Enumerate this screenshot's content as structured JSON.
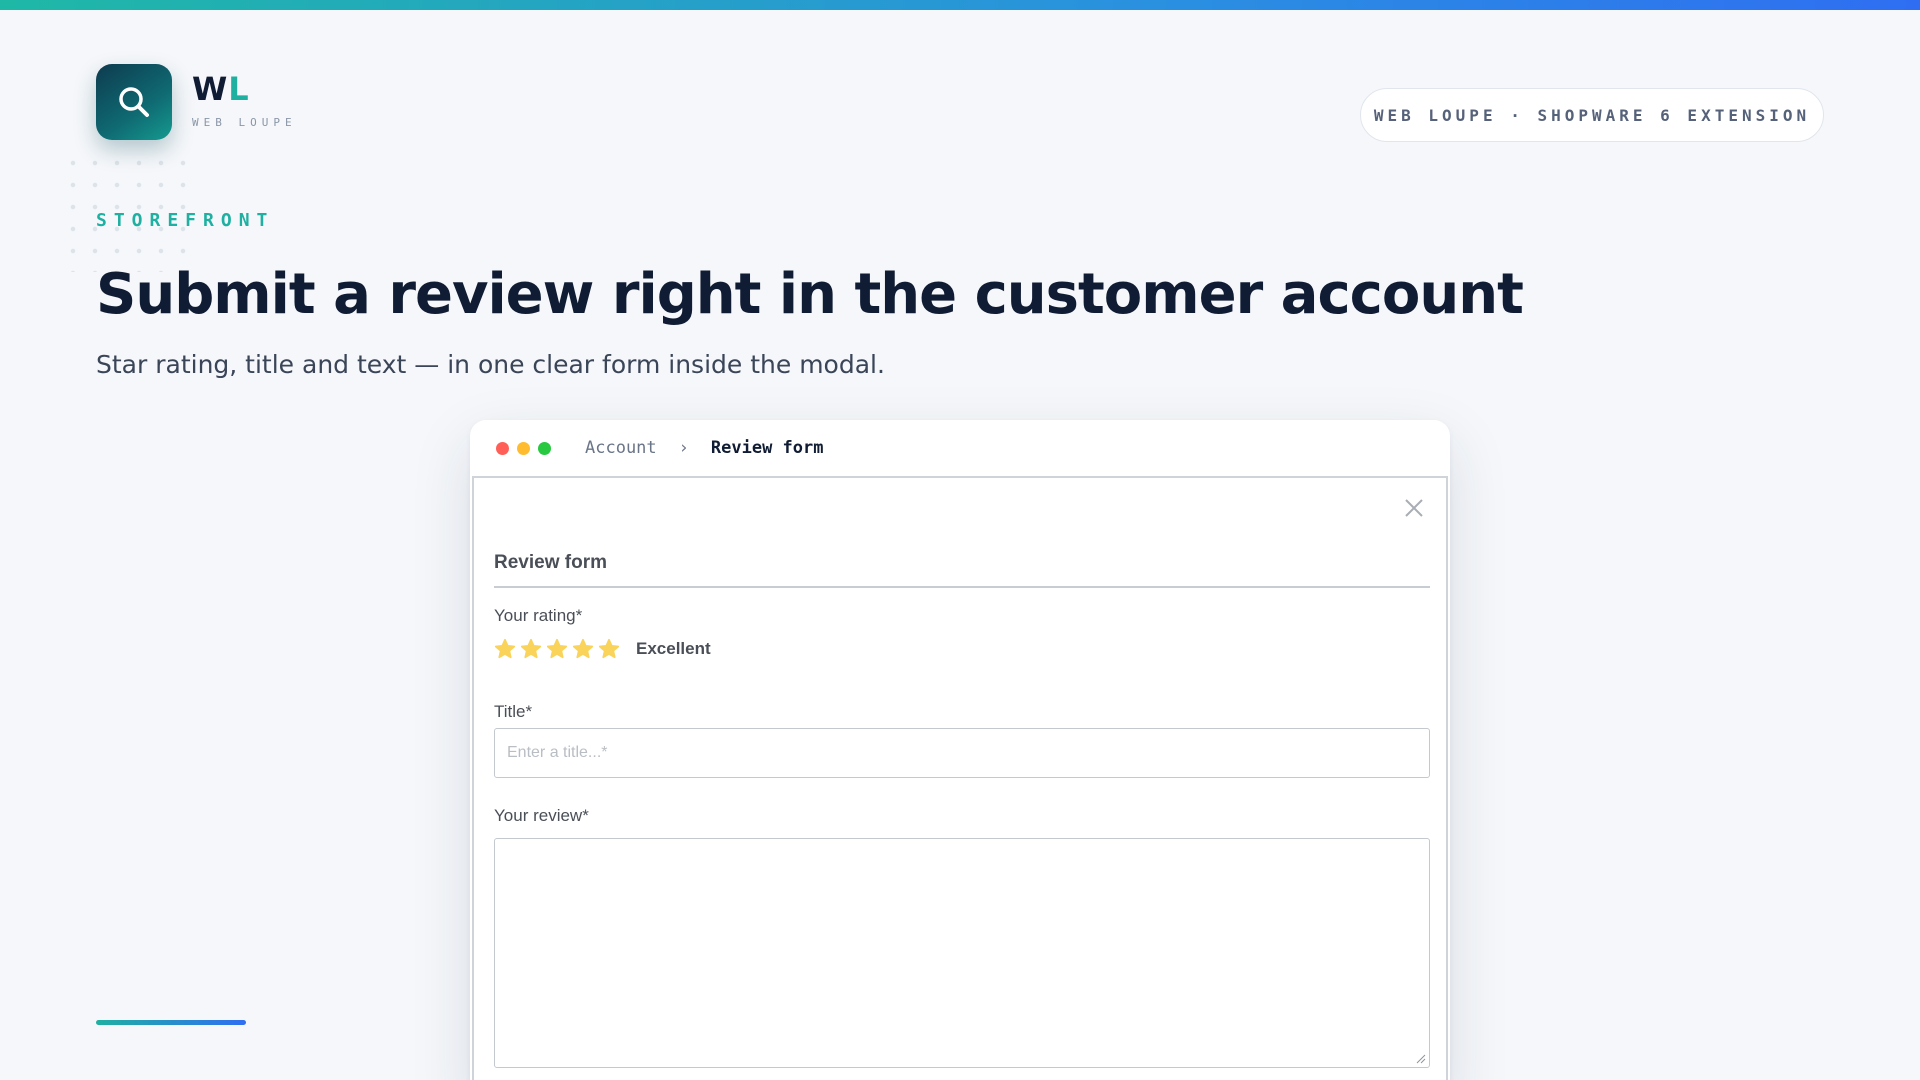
{
  "brand": {
    "logo_initial_1": "W",
    "logo_initial_2": "L",
    "logo_subtitle": "WEB LOUPE",
    "logo_icon": "search-icon",
    "accent_color": "#1fb0a2",
    "secondary_color": "#2f6ef2"
  },
  "header": {
    "pill_text": "WEB LOUPE · SHOPWARE 6 EXTENSION"
  },
  "hero": {
    "eyebrow": "STOREFRONT",
    "title": "Submit a review right in the customer account",
    "subtitle": "Star rating, title and text — in one clear form inside the modal."
  },
  "window": {
    "breadcrumb": {
      "parent": "Account",
      "separator": "›",
      "current": "Review form"
    }
  },
  "review_form": {
    "title": "Review form",
    "close_icon": "close-icon",
    "rating": {
      "label": "Your rating*",
      "stars_filled": 5,
      "stars_total": 5,
      "value_text": "Excellent",
      "star_color": "#f9d35a"
    },
    "title_field": {
      "label": "Title*",
      "placeholder": "Enter a title...*",
      "value": ""
    },
    "review_field": {
      "label": "Your review*",
      "value": ""
    }
  }
}
